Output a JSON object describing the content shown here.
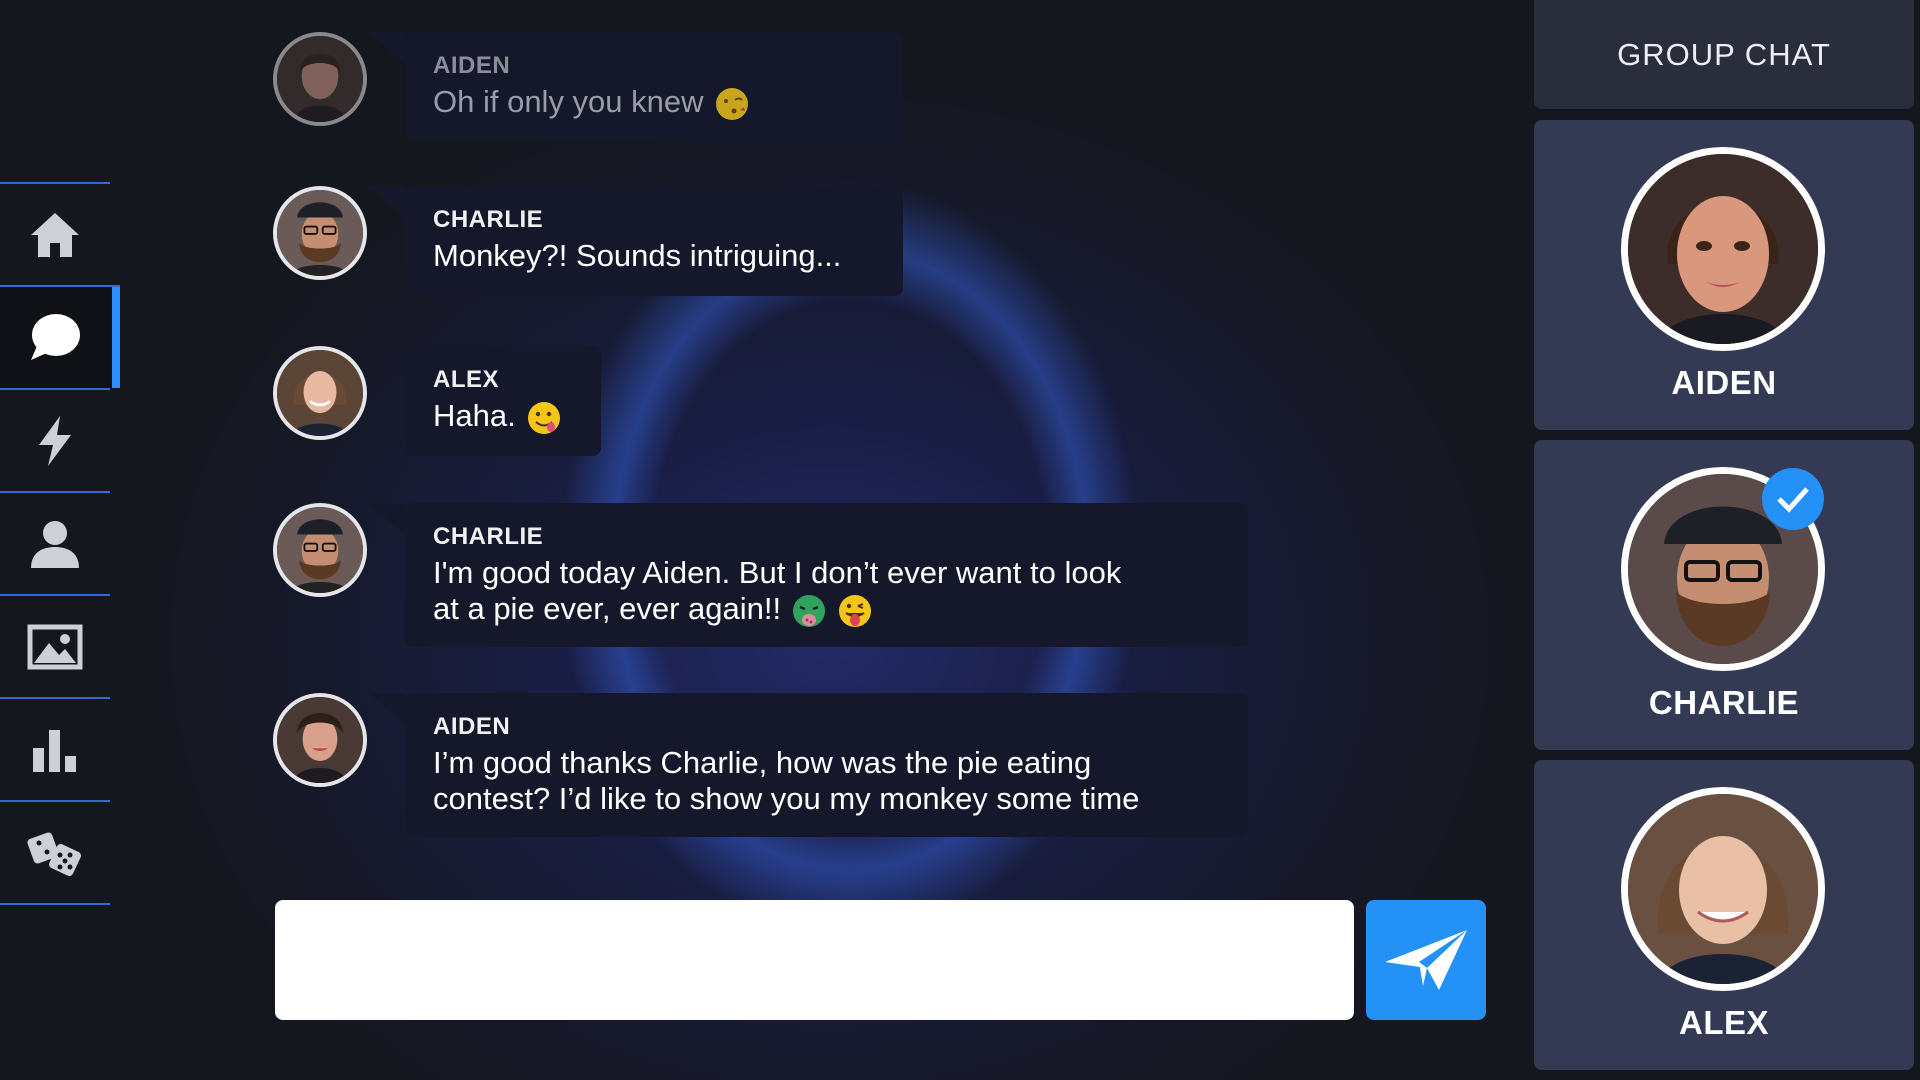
{
  "nav": {
    "items": [
      {
        "name": "home",
        "icon": "home-icon",
        "active": false
      },
      {
        "name": "chat",
        "icon": "chat-bubble-icon",
        "active": true
      },
      {
        "name": "activity",
        "icon": "lightning-icon",
        "active": false
      },
      {
        "name": "profile",
        "icon": "user-icon",
        "active": false
      },
      {
        "name": "gallery",
        "icon": "image-icon",
        "active": false
      },
      {
        "name": "stats",
        "icon": "bar-chart-icon",
        "active": false
      },
      {
        "name": "games",
        "icon": "dice-icon",
        "active": false
      }
    ]
  },
  "messages": [
    {
      "sender": "AIDEN",
      "text": "Oh if only you knew",
      "emojis": [
        "kissing-face-emoji"
      ],
      "faded": true
    },
    {
      "sender": "CHARLIE",
      "text": "Monkey?! Sounds intriguing...",
      "emojis": []
    },
    {
      "sender": "ALEX",
      "text": "Haha.",
      "emojis": [
        "drooling-face-emoji"
      ]
    },
    {
      "sender": "CHARLIE",
      "text_line1": "I'm good today Aiden. But I don’t ever want to look",
      "text_line2": "at a pie ever, ever again!!",
      "emojis": [
        "nauseated-face-emoji",
        "tongue-face-emoji"
      ]
    },
    {
      "sender": "AIDEN",
      "text_line1": "I’m good thanks Charlie, how was the pie eating",
      "text_line2": "contest? I’d like to show you my monkey some time",
      "emojis": []
    }
  ],
  "composer": {
    "placeholder": "",
    "send_icon": "paper-plane-icon"
  },
  "panel": {
    "title": "GROUP CHAT",
    "members": [
      {
        "name": "AIDEN",
        "selected": false
      },
      {
        "name": "CHARLIE",
        "selected": true
      },
      {
        "name": "ALEX",
        "selected": false
      }
    ]
  },
  "colors": {
    "accent": "#2491f6",
    "nav_divider": "#2f6bd8",
    "bubble": "#15182a",
    "member_card": "#343954"
  }
}
